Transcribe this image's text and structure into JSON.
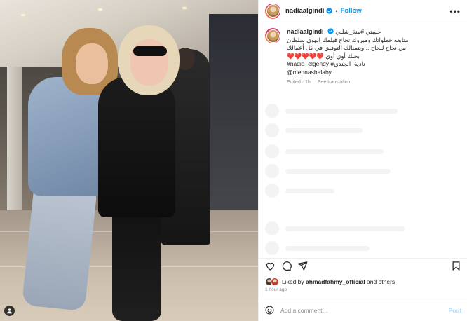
{
  "header": {
    "username": "nadiaalgindi",
    "separator": "•",
    "follow_label": "Follow",
    "more_label": "•••"
  },
  "caption": {
    "username": "nadiaalgindi",
    "lines": [
      "حبيبتي #منة_شلبي",
      "متابعه خطواتك ومبروك نجاح فيلمك الهوي سلطان",
      "من نجاح لنجاح .. وبتمنالك التوفيق في كل أعمالك",
      "بحبك أوي أوي ❤️❤️❤️❤️❤️",
      "#nadia_elgendy #نادية_الجندي",
      "@mennashalaby"
    ],
    "edited": "Edited · 1h",
    "see_translation": "See translation"
  },
  "likes": {
    "prefix": "Liked by",
    "user": "ahmadfahmy_official",
    "suffix": "and others"
  },
  "time_ago": "1 hour ago",
  "comment": {
    "placeholder": "Add a comment…",
    "post_label": "Post"
  },
  "icons": {
    "like": "heart-icon",
    "comment": "comment-icon",
    "share": "share-icon",
    "save": "bookmark-icon",
    "emoji": "emoji-icon",
    "tag": "user-tag-icon",
    "verified": "verified-badge-icon"
  },
  "colors": {
    "accent": "#0095f6",
    "text": "#262626",
    "muted": "#8e8e8e",
    "post_disabled": "#b2dffc"
  }
}
